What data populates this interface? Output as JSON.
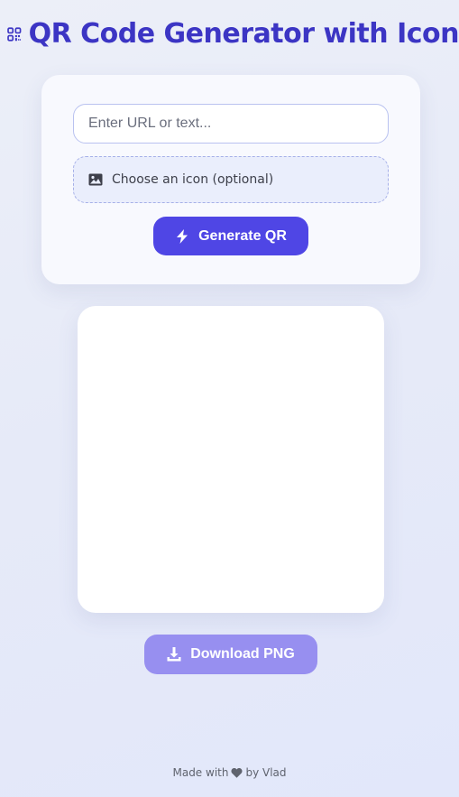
{
  "header": {
    "title": "QR Code Generator with Icon",
    "icon": "qrcode-icon"
  },
  "form": {
    "url_placeholder": "Enter URL or text...",
    "url_value": "",
    "icon_picker_label": "Choose an icon (optional)",
    "icon_picker_icon": "image-icon",
    "generate_label": "Generate QR",
    "generate_icon": "bolt-icon"
  },
  "preview": {
    "content": ""
  },
  "download": {
    "label": "Download PNG",
    "icon": "download-icon",
    "enabled": false
  },
  "footer": {
    "made_with": "Made with",
    "heart_icon": "heart-icon",
    "by": "by Vlad"
  },
  "colors": {
    "accent": "#4f46e5",
    "title": "#3c35c4",
    "download_disabled": "#978ff0",
    "background": "#e8ecf9"
  }
}
